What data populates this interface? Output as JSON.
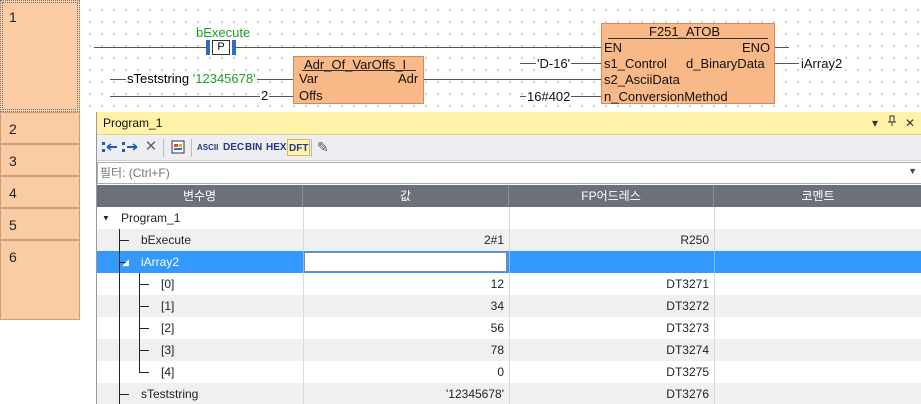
{
  "networks": {
    "row1": "1",
    "row2": "2",
    "row3": "3",
    "row4": "4",
    "row5": "5",
    "row6": "6"
  },
  "ladder": {
    "contact_var": "bExecute",
    "contact_symbol": "P",
    "fb_adr": {
      "title": "Adr_Of_VarOffs_I",
      "in_var": "Var",
      "in_offs": "Offs",
      "out_adr": "Adr"
    },
    "input_string_name": "sTeststring",
    "input_string_value": "'12345678'",
    "offs_value": "2",
    "fb_atob": {
      "title": "F251_ATOB",
      "en": "EN",
      "eno": "ENO",
      "s1": "s1_Control",
      "s2": "s2_AsciiData",
      "n": "n_ConversionMethod",
      "out": "d_BinaryData"
    },
    "control_value": "'D-16'",
    "method_value": "16#402",
    "output_var": "iArray2"
  },
  "panel": {
    "title": "Program_1",
    "pin_glyph": "▾",
    "pin2_glyph": "ᵩ",
    "close_glyph": "✕",
    "toolbar": {
      "ascii": "ASCII",
      "dec": "DEC",
      "bin": "BIN",
      "hex": "HEX",
      "dft": "DFT"
    },
    "filter_placeholder": "필터: (Ctrl+F)",
    "columns": {
      "name": "변수명",
      "value": "값",
      "fp_address": "FP어드레스",
      "comment": "코멘트"
    },
    "rows": [
      {
        "name": "Program_1",
        "value": "",
        "addr": "",
        "comment": ""
      },
      {
        "name": "bExecute",
        "value": "2#1",
        "addr": "R250",
        "comment": ""
      },
      {
        "name": "iArray2",
        "value": "",
        "addr": "",
        "comment": ""
      },
      {
        "name": "[0]",
        "value": "12",
        "addr": "DT3271",
        "comment": ""
      },
      {
        "name": "[1]",
        "value": "34",
        "addr": "DT3272",
        "comment": ""
      },
      {
        "name": "[2]",
        "value": "56",
        "addr": "DT3273",
        "comment": ""
      },
      {
        "name": "[3]",
        "value": "78",
        "addr": "DT3274",
        "comment": ""
      },
      {
        "name": "[4]",
        "value": "0",
        "addr": "DT3275",
        "comment": ""
      },
      {
        "name": "sTeststring",
        "value": "'12345678'",
        "addr": "DT3276",
        "comment": ""
      }
    ]
  }
}
